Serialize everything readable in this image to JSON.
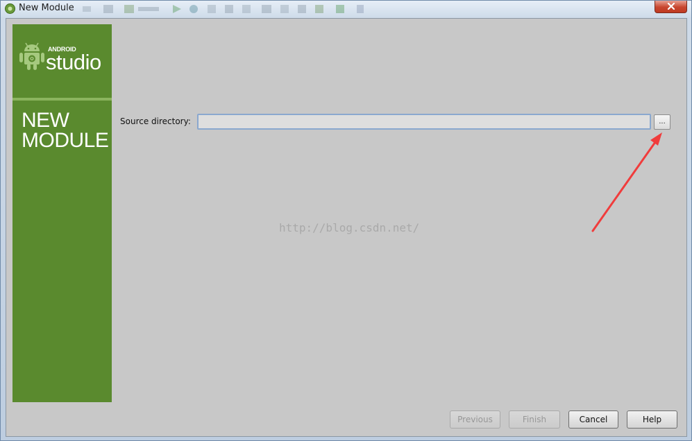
{
  "window": {
    "title": "New Module"
  },
  "sidebar": {
    "logo_small": "ANDROID",
    "logo_large": "studio",
    "title_line1": "NEW",
    "title_line2": "MODULE"
  },
  "form": {
    "source_label": "Source directory:",
    "source_value": "",
    "browse_label": "..."
  },
  "watermark": "http://blog.csdn.net/",
  "footer": {
    "previous": "Previous",
    "finish": "Finish",
    "cancel": "Cancel",
    "help": "Help"
  },
  "icons": {
    "app": "android-studio-icon",
    "close": "close-icon",
    "logo": "android-robot-icon",
    "annotation": "red-arrow-icon"
  },
  "colors": {
    "sidebar_green": "#5a8a2e",
    "sidebar_divider": "#8bb45e",
    "content_bg": "#c8c8c8",
    "input_focus_border": "#8aa8cf",
    "close_red": "#c7462f",
    "annotation_red": "#f03c3c"
  }
}
